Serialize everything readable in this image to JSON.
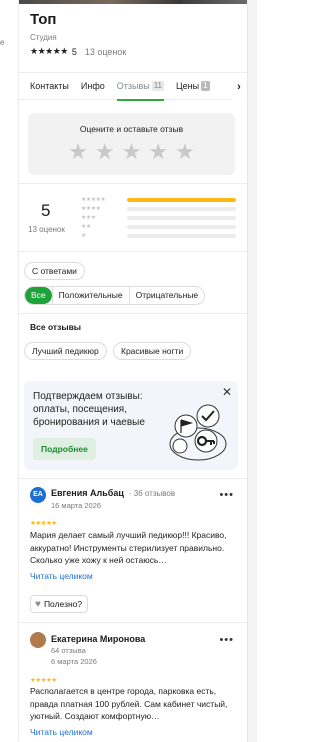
{
  "background": {
    "left_fragment": "е"
  },
  "place": {
    "name": "Топ",
    "category": "Студия",
    "stars": "★★★★★",
    "rating": "5",
    "ratings_count": "13 оценок"
  },
  "tabs": {
    "items": [
      {
        "label": "Контакты",
        "count": ""
      },
      {
        "label": "Инфо",
        "count": ""
      },
      {
        "label": "Отзывы",
        "count": "11",
        "active": true
      },
      {
        "label": "Цены",
        "count": "1"
      }
    ],
    "scroll_arrow": "›"
  },
  "rate_prompt": {
    "label": "Оцените и оставьте отзыв",
    "star_glyph": "★"
  },
  "summary": {
    "score": "5",
    "caption": "13 оценок",
    "distribution": [
      {
        "stars": "★★★★★",
        "fraction": 1.0
      },
      {
        "stars": "★★★★",
        "fraction": 0.0
      },
      {
        "stars": "★★★",
        "fraction": 0.0
      },
      {
        "stars": "★★",
        "fraction": 0.0
      },
      {
        "stars": "★",
        "fraction": 0.0
      }
    ]
  },
  "filters": {
    "with_answers": "С ответами",
    "segments": [
      "Все",
      "Положительные",
      "Отрицательные"
    ],
    "active_segment": "Все"
  },
  "all_reviews": {
    "title": "Все отзывы",
    "tags": [
      "Лучший педикюр",
      "Красивые ногти"
    ]
  },
  "promo": {
    "text": "Подтверждаем отзывы: оплаты, посещения, бронирования и чаевые",
    "button": "Подробнее",
    "close": "✕"
  },
  "reviews": [
    {
      "initials": "ЕА",
      "avatar_color": "#1e6fd0",
      "author": "Евгения Альбац",
      "author_meta": "· 36 отзывов",
      "sub": "",
      "date": "16 марта 2026",
      "stars": "★★★★★",
      "text": "Мария делает самый лучший педикюр!!! Красиво, аккуратно! Инструменты стерилизует правильно. Сколько уже хожу к ней остаюсь…",
      "read_more": "Читать целиком",
      "useful": "Полезно?"
    },
    {
      "initials": "",
      "avatar_color": "#b07a4a",
      "author": "Екатерина Миронова",
      "author_meta": "",
      "sub": "64 отзыва",
      "date": "6 марта 2026",
      "stars": "★★★★★",
      "text": "Располагается в центре города, парковка есть, правда платная 100 рублей. Сам кабинет чистый, уютный. Создают комфортную…",
      "read_more": "Читать целиком"
    }
  ],
  "more_glyph": "•••",
  "colors": {
    "accent_green": "#1ea33a",
    "star_yellow": "#fcb814",
    "link_blue": "#1e6fd0"
  }
}
